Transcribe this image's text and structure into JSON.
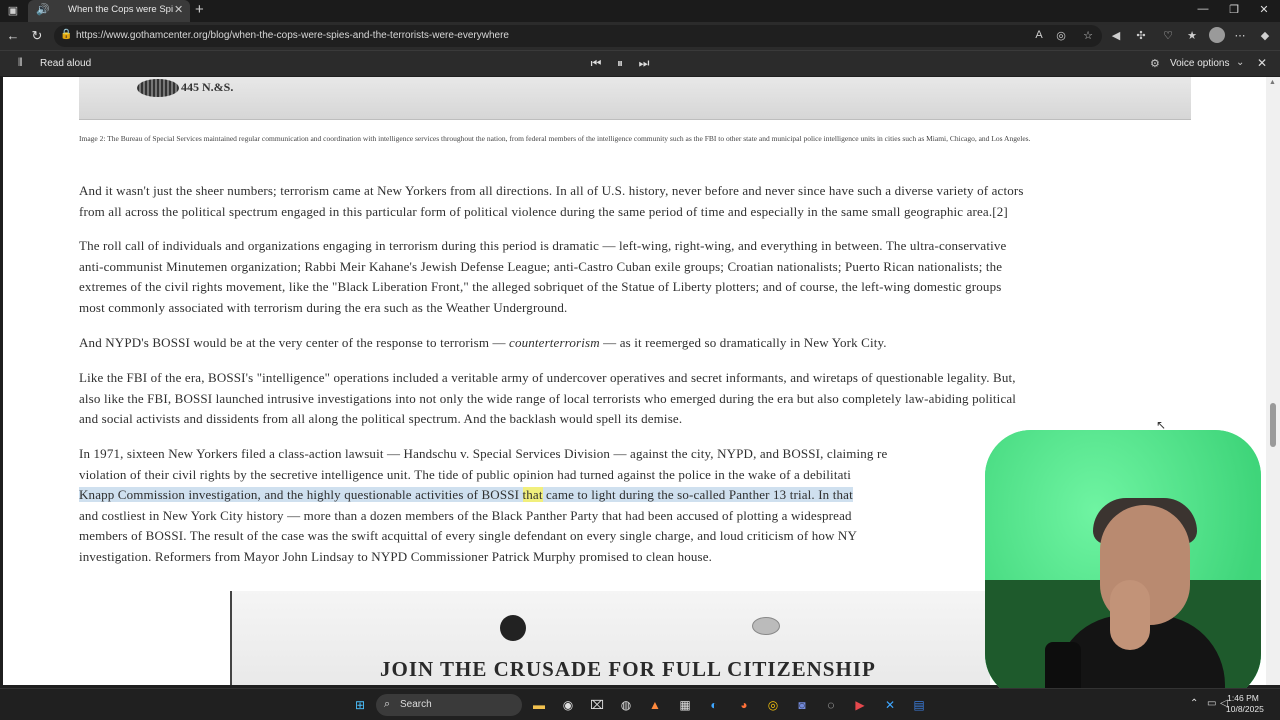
{
  "browser": {
    "tab_title": "When the Cops were Spies...",
    "new_tab_label": "+",
    "url": "https://www.gothamcenter.org/blog/when-the-cops-were-spies-and-the-terrorists-were-everywhere"
  },
  "read_aloud": {
    "label": "Read aloud",
    "voice_options_label": "Voice options"
  },
  "article": {
    "image_label": "445 N.&S.",
    "caption": "Image 2: The Bureau of Special Services maintained regular communication and coordination with intelligence services throughout the nation, from federal members of the intelligence community such as the FBI to other state and municipal police intelligence units in cities such as Miami, Chicago, and Los Angeles.",
    "p1": [
      "And it wasn't just the sheer numbers; terrorism came at New Yorkers from all directions. In all of U.S. history, never before and never since have such a diverse variety of actors",
      "from all across the political spectrum engaged in this particular form of political violence during the same period of time and especially in the same small geographic area.[2]"
    ],
    "p2": [
      "The roll call of individuals and organizations engaging in terrorism during this period is dramatic — left-wing, right-wing, and everything in between. The ultra-conservative",
      "anti-communist Minutemen organization; Rabbi Meir Kahane's Jewish Defense League; anti-Castro Cuban exile groups; Croatian nationalists; Puerto Rican nationalists; the",
      "extremes of the civil rights movement, like the \"Black Liberation Front,\" the alleged sobriquet of the Statue of Liberty plotters; and of course, the left-wing domestic groups",
      "most commonly associated with terrorism during the era such as the Weather Underground."
    ],
    "p3": {
      "before": "And NYPD's BOSSI would be at the very center of the response to terrorism — ",
      "italic": "counterterrorism",
      "after": " — as it reemerged so dramatically in New York City."
    },
    "p4": [
      "Like the FBI of the era, BOSSI's \"intelligence\" operations included a veritable army of undercover operatives and secret informants, and wiretaps of questionable legality.  But,",
      "also like the FBI, BOSSI launched intrusive investigations into not only the wide range of local terrorists who emerged during the era but also completely law-abiding political",
      "and social activists and dissidents from all along the political spectrum. And the backlash would spell its demise."
    ],
    "p5": {
      "line1": "In 1971, sixteen New Yorkers filed a class-action lawsuit — Handschu v. Special Services Division — against the city, NYPD, and BOSSI, claiming re",
      "line2": "violation of their civil rights by the secretive intelligence unit.  The tide of public opinion had turned against the police in the wake of a debilitati",
      "line3_before": "Knapp Commission investigation, and the highly questionable activities of BOSSI ",
      "line3_word": "that",
      "line3_after": " came to light during the so-called Panther 13 trial. In that",
      "line4": "and costliest in New York City history — more than a dozen members of the Black Panther Party that had been accused of plotting a widespread",
      "line5": "members of BOSSI.  The result of the case was the swift acquittal of every single defendant on every single charge, and loud criticism of how NY",
      "line6": "investigation. Reformers from Mayor John Lindsay to NYPD Commissioner Patrick Murphy promised to clean house."
    },
    "poster_headline": "JOIN THE CRUSADE FOR FULL CITIZENSHIP"
  },
  "taskbar": {
    "search_label": "Search",
    "time": "1:46 PM",
    "date": "10/8/2025"
  },
  "colors": {
    "selection_highlight": "#cfe0ef",
    "word_highlight": "#f1ef7c",
    "webcam_background": "#56e48c"
  }
}
